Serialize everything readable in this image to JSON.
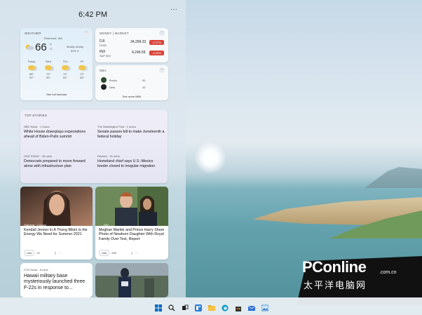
{
  "clock": "6:42 PM",
  "panel_more": "···",
  "weather": {
    "title": "WEATHER",
    "location": "Redmond, WA",
    "temp": "66",
    "unit_f": "°F",
    "unit_c": "°C",
    "condition": "Mostly cloudy",
    "details": "54%  0",
    "days": [
      {
        "name": "Today",
        "high": "68°",
        "low": "52°"
      },
      {
        "name": "Wed",
        "high": "72°",
        "low": "55°"
      },
      {
        "name": "Thu",
        "high": "70°",
        "low": "54°"
      },
      {
        "name": "Fri",
        "high": "72°",
        "low": "55°"
      }
    ],
    "link": "See full forecast"
  },
  "market": {
    "title": "MONEY | MARKET",
    "rows": [
      {
        "sym": "DJI",
        "sub": "DOW",
        "value": "34,299.33",
        "change": "-0.27%"
      },
      {
        "sym": "INX",
        "sub": "S&P 500",
        "value": "4,246.59",
        "change": "-0.20%"
      }
    ]
  },
  "nba": {
    "title": "NBA",
    "teams": [
      {
        "name": "Bucks",
        "score": "59"
      },
      {
        "name": "Nets",
        "score": "43"
      }
    ],
    "link": "See more NBA"
  },
  "stories": {
    "title": "TOP STORIES",
    "items": [
      {
        "source": "NBC News · 1 hours",
        "headline": "White House downplays expectations ahead of Biden-Putin summit"
      },
      {
        "source": "The Washington Post · 1 hours",
        "headline": "Senate passes bill to make Juneteenth a federal holiday"
      },
      {
        "source": "USA TODAY · 45 mins",
        "headline": "Democrats prepared to move forward alone with infrastructure plan"
      },
      {
        "source": "Reuters · 41 mins",
        "headline": "Homeland chief says U.S.-Mexico border closed to irregular migration"
      }
    ]
  },
  "news_cards": [
    {
      "source": "Glamour · 1 hours",
      "headline": "Kendall Jenner In A Thong Bikini Is the Energy We Need for Summer 2021",
      "like": "Like",
      "reactions": "22"
    },
    {
      "source": "OK!",
      "headline": "Meghan Markle and Prince Harry Share Photo of Newborn Daughter With Royal Family Over Text, Report",
      "like": "Like",
      "reactions": "699"
    },
    {
      "source": "FOX News · 8 mins",
      "headline": "Hawaii military base mysteriously launched three F-22s in response to..."
    }
  ],
  "watermark": {
    "brand": "PConline",
    "domain": ".com.cn",
    "tagline": "太平洋电脑网"
  },
  "colors": {
    "accent": "#0067c0",
    "negative": "#d9463b"
  },
  "taskbar_icons": [
    "windows-start-icon",
    "search-icon",
    "task-view-icon",
    "widgets-icon",
    "file-explorer-icon",
    "edge-browser-icon",
    "store-icon",
    "mail-icon",
    "photos-icon"
  ]
}
